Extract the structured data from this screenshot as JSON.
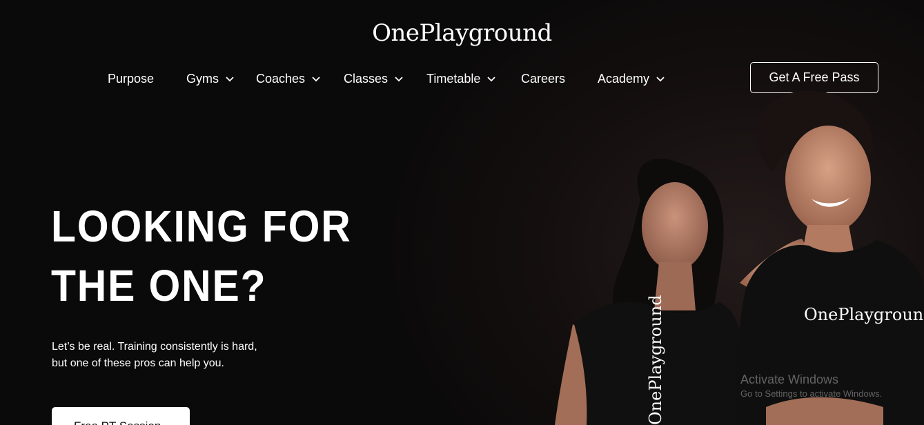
{
  "brand": {
    "logo_text": "OnePlayground",
    "shirt_text": "OnePlayground"
  },
  "nav": {
    "items": [
      {
        "label": "Purpose",
        "dropdown": false
      },
      {
        "label": "Gyms",
        "dropdown": true
      },
      {
        "label": "Coaches",
        "dropdown": true
      },
      {
        "label": "Classes",
        "dropdown": true
      },
      {
        "label": "Timetable",
        "dropdown": true
      },
      {
        "label": "Careers",
        "dropdown": false
      },
      {
        "label": "Academy",
        "dropdown": true
      }
    ],
    "cta_label": "Get A Free Pass"
  },
  "hero": {
    "headline_line1": "LOOKING FOR",
    "headline_line2": "THE ONE?",
    "subtext_line1": "Let’s be real. Training consistently is hard,",
    "subtext_line2": "but one of these pros can help you.",
    "button_label": "Free PT Session"
  },
  "overlay": {
    "watermark_title": "Activate Windows",
    "watermark_sub": "Go to Settings to activate Windows."
  },
  "colors": {
    "background": "#0b0a0a",
    "text": "#ffffff",
    "button_bg": "#ffffff",
    "button_text": "#111111"
  },
  "icons": {
    "dropdown": "chevron-down-icon"
  }
}
